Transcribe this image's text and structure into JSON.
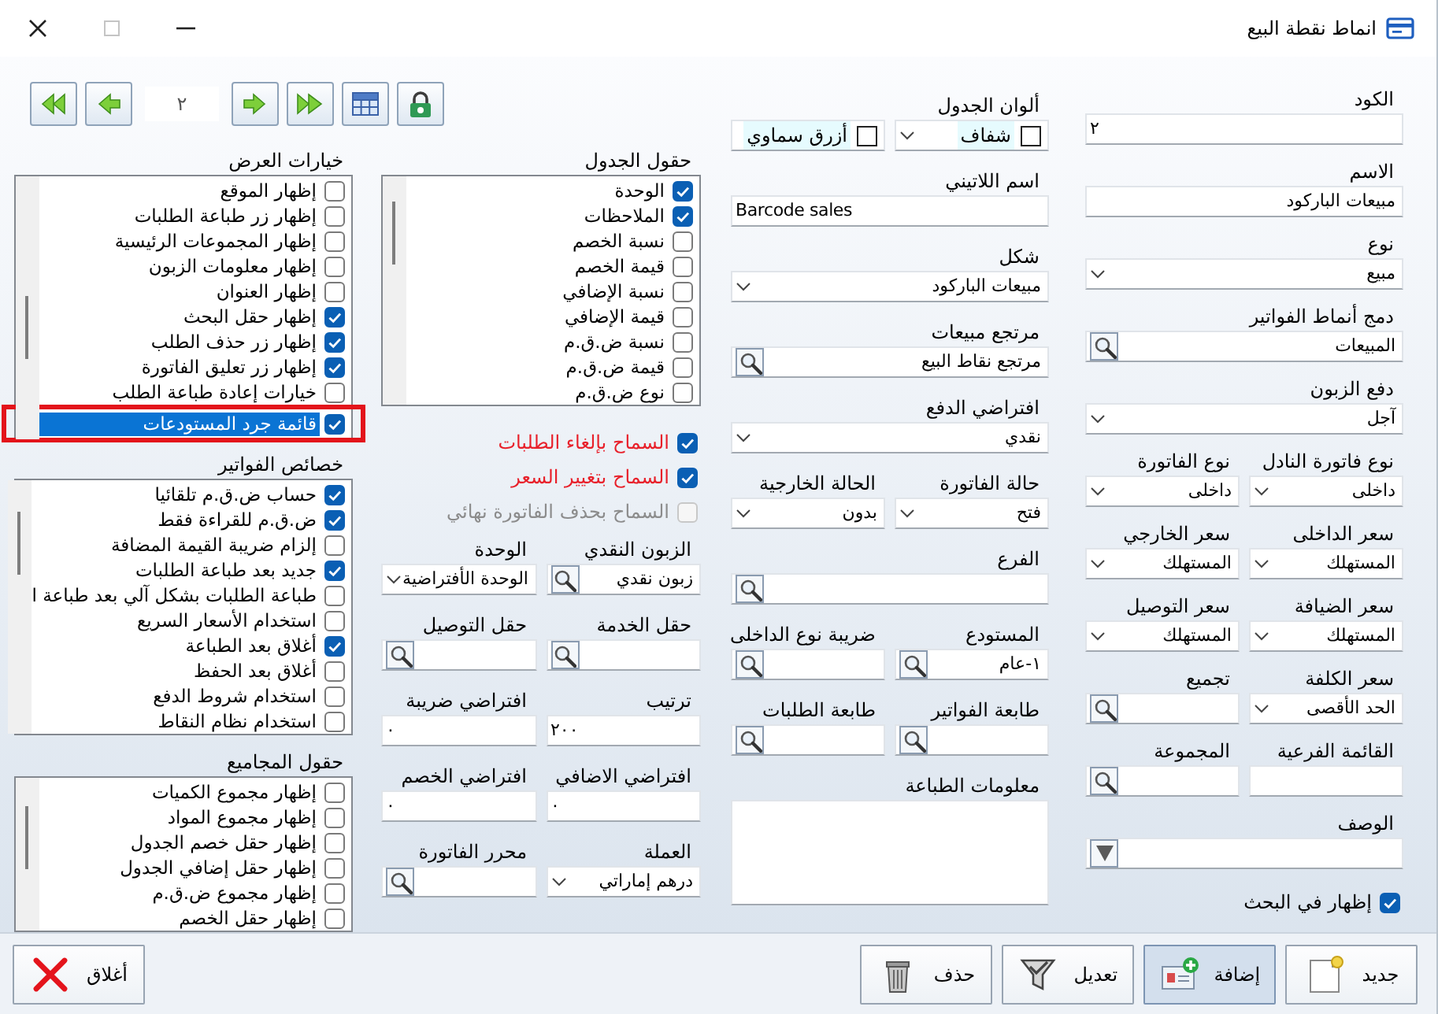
{
  "window": {
    "title": "انماط نقطة البيع",
    "controls": [
      {
        "kind": "close",
        "disabled": false
      },
      {
        "kind": "maximize",
        "disabled": true
      },
      {
        "kind": "minimize",
        "disabled": false
      }
    ]
  },
  "navigator": {
    "page": "٢"
  },
  "form_right": [
    [
      {
        "label": "الكود",
        "kind": "text",
        "value": "٢"
      }
    ],
    [
      {
        "label": "الاسم",
        "kind": "text",
        "value": "مبيعات الباركود"
      }
    ],
    [
      {
        "label": "نوع",
        "kind": "combo",
        "value": "مبيع"
      }
    ],
    [
      {
        "label": "دمج أنماط الفواتير",
        "kind": "lookup",
        "value": "المبيعات"
      }
    ],
    [
      {
        "label": "دفع الزبون",
        "kind": "combo",
        "value": "آجل"
      }
    ],
    [
      {
        "label": "نوع فاتورة النادل",
        "kind": "combo",
        "value": "داخلى"
      },
      {
        "label": "نوع الفاتورة",
        "kind": "combo",
        "value": "داخلى"
      }
    ],
    [
      {
        "label": "سعر الداخلى",
        "kind": "combo",
        "value": "المستهلك"
      },
      {
        "label": "سعر الخارجي",
        "kind": "combo",
        "value": "المستهلك"
      }
    ],
    [
      {
        "label": "سعر الضيافة",
        "kind": "combo",
        "value": "المستهلك"
      },
      {
        "label": "سعر التوصيل",
        "kind": "combo",
        "value": "المستهلك"
      }
    ],
    [
      {
        "label": "سعر الكلفة",
        "kind": "combo",
        "value": "الحد الأقصى"
      },
      {
        "label": "تجميع",
        "kind": "lookup"
      }
    ],
    [
      {
        "label": "القائمة الفرعية",
        "kind": "text"
      },
      {
        "label": "المجموعة",
        "kind": "lookup"
      }
    ],
    [
      {
        "label": "الوصف",
        "kind": "picker"
      }
    ],
    [
      {
        "label": "إظهار في البحث",
        "kind": "check",
        "checked": true
      }
    ]
  ],
  "form_middle": [
    [
      {
        "label": "ألوان الجدول",
        "kind": "color",
        "value": "شفاف"
      },
      {
        "kind": "color",
        "value": "أزرق سماوي"
      }
    ],
    [
      {
        "label": "اسم اللاتيني",
        "kind": "text",
        "value": "Barcode sales"
      }
    ],
    [
      {
        "label": "شكل",
        "kind": "combo",
        "value": "مبيعات الباركود"
      }
    ],
    [
      {
        "label": "مرتجع مبيعات",
        "kind": "lookup",
        "value": "مرتجع نقاط البيع"
      }
    ],
    [
      {
        "label": "افتراضي الدفع",
        "kind": "combo",
        "value": "نقدي"
      }
    ],
    [
      {
        "label": "حالة الفاتورة",
        "kind": "combo",
        "value": "فتح"
      },
      {
        "label": "الحالة الخارجية",
        "kind": "combo",
        "value": "بدون"
      }
    ],
    [
      {
        "label": "الفرع",
        "kind": "lookup"
      }
    ],
    [
      {
        "label": "المستودع",
        "kind": "lookup",
        "value": "١-عام"
      },
      {
        "label": "ضريبة نوع الداخلى",
        "kind": "lookup"
      }
    ],
    [
      {
        "label": "طابعة الفواتير",
        "kind": "lookup"
      },
      {
        "label": "طابعة الطلبات",
        "kind": "lookup"
      }
    ],
    [
      {
        "label": "معلومات الطباعة",
        "kind": "textarea"
      }
    ]
  ],
  "table_fields": {
    "title": "حقول الجدول",
    "items": [
      {
        "label": "الوحدة",
        "checked": true,
        "selected": false
      },
      {
        "label": "الملاحظات",
        "checked": true,
        "selected": false
      },
      {
        "label": "نسبة الخصم",
        "checked": false,
        "selected": false
      },
      {
        "label": "قيمة الخصم",
        "checked": false,
        "selected": false
      },
      {
        "label": "نسبة الإضافي",
        "checked": false,
        "selected": false
      },
      {
        "label": "قيمة الإضافي",
        "checked": false,
        "selected": false
      },
      {
        "label": "نسبة ض.ق.م",
        "checked": false,
        "selected": false
      },
      {
        "label": "قيمة ض.ق.م",
        "checked": false,
        "selected": false
      },
      {
        "label": "نوع ض.ق.م",
        "checked": false,
        "selected": false
      }
    ]
  },
  "permissions": [
    {
      "label": "السماح بإلغاء الطلبات",
      "checked": true,
      "disabled": false,
      "color": "#e8202a"
    },
    {
      "label": "السماح بتغيير السعر",
      "checked": true,
      "disabled": false,
      "color": "#e8202a"
    },
    {
      "label": "السماح بحذف الفاتورة نهائي",
      "checked": false,
      "disabled": true,
      "color": "#8c8c8c"
    }
  ],
  "form_left": [
    [
      {
        "label": "الزبون النقدي",
        "kind": "lookup",
        "value": "زبون نقدي"
      },
      {
        "label": "الوحدة",
        "kind": "combo",
        "value": "الوحدة الأفتراضية"
      }
    ],
    [
      {
        "label": "حقل الخدمة",
        "kind": "lookup"
      },
      {
        "label": "حقل التوصيل",
        "kind": "lookup"
      }
    ],
    [
      {
        "label": "ترتيب",
        "kind": "text",
        "value": "٢٠٠"
      },
      {
        "label": "افتراضي ضريبة",
        "kind": "text",
        "value": "٠"
      }
    ],
    [
      {
        "label": "افتراضي الاضافي",
        "kind": "text",
        "value": "٠"
      },
      {
        "label": "افتراضي الخصم",
        "kind": "text",
        "value": "٠"
      }
    ],
    [
      {
        "label": "العملة",
        "kind": "combo",
        "value": "درهم إماراتي"
      },
      {
        "label": "محرر الفاتورة",
        "kind": "lookup"
      }
    ]
  ],
  "display_options": {
    "title": "خيارات العرض",
    "items": [
      {
        "label": "إظهار الموقع",
        "checked": false,
        "selected": false,
        "highlighted": false
      },
      {
        "label": "إظهار زر طباعة الطلبات",
        "checked": false,
        "selected": false,
        "highlighted": false
      },
      {
        "label": "إظهار المجموعات الرئيسية",
        "checked": false,
        "selected": false,
        "highlighted": false
      },
      {
        "label": "إظهار معلومات الزبون",
        "checked": false,
        "selected": false,
        "highlighted": false
      },
      {
        "label": "إظهار العنوان",
        "checked": false,
        "selected": false,
        "highlighted": false
      },
      {
        "label": "إظهار حقل البحث",
        "checked": true,
        "selected": false,
        "highlighted": false
      },
      {
        "label": "إظهار زر حذف الطلب",
        "checked": true,
        "selected": false,
        "highlighted": false
      },
      {
        "label": "إظهار زر تعليق الفاتورة",
        "checked": true,
        "selected": false,
        "highlighted": false
      },
      {
        "label": "خيارات إعادة طباعة الطلب",
        "checked": false,
        "selected": false,
        "highlighted": false
      },
      {
        "label": "قائمة جرد المستودعات",
        "checked": true,
        "selected": true,
        "highlighted": true
      }
    ]
  },
  "invoice_properties": {
    "title": "خصائص الفواتير",
    "items": [
      {
        "label": "حساب ض.ق.م تلقائيا",
        "checked": true,
        "selected": false
      },
      {
        "label": "ض.ق.م للقراءة فقط",
        "checked": true,
        "selected": false
      },
      {
        "label": "إلزام ضريبة القيمة المضافة",
        "checked": false,
        "selected": false
      },
      {
        "label": "جديد بعد طباعة الطلبات",
        "checked": true,
        "selected": false
      },
      {
        "label": "طباعة الطلبات بشكل آلي بعد طباعة ا",
        "checked": false,
        "selected": false
      },
      {
        "label": "استخدام الأسعار السريع",
        "checked": false,
        "selected": false
      },
      {
        "label": "أغلاق بعد الطباعة",
        "checked": true,
        "selected": false
      },
      {
        "label": "أغلاق بعد الحفظ",
        "checked": false,
        "selected": false
      },
      {
        "label": "استخدام شروط الدفع",
        "checked": false,
        "selected": false
      },
      {
        "label": "استخدام نظام النقاط",
        "checked": false,
        "selected": false
      }
    ]
  },
  "totals_fields": {
    "title": "حقول المجاميع",
    "items": [
      {
        "label": "إظهار مجموع الكميات",
        "checked": false,
        "selected": false
      },
      {
        "label": "إظهار مجموع المواد",
        "checked": false,
        "selected": false
      },
      {
        "label": "إظهار حقل خصم الجدول",
        "checked": false,
        "selected": false
      },
      {
        "label": "إظهار حقل إضافي الجدول",
        "checked": false,
        "selected": false
      },
      {
        "label": "إظهار مجموع ض.ق.م",
        "checked": false,
        "selected": false
      },
      {
        "label": "إظهار حقل الخصم",
        "checked": false,
        "selected": false
      }
    ]
  },
  "buttons": [
    {
      "label": "جديد",
      "kind": "new",
      "pressed": false
    },
    {
      "label": "إضافة",
      "kind": "add",
      "pressed": true
    },
    {
      "label": "تعديل",
      "kind": "edit",
      "pressed": false
    },
    {
      "label": "حذف",
      "kind": "delete",
      "pressed": false
    },
    {
      "label": "أغلاق",
      "kind": "close",
      "pressed": false
    }
  ]
}
